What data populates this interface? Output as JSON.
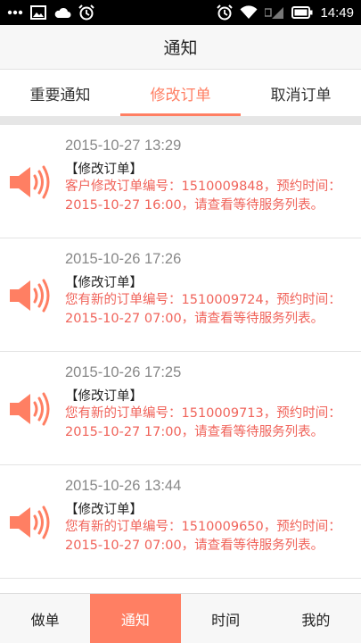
{
  "status_bar": {
    "left_icons": [
      "more-dots-icon",
      "image-icon",
      "cloud-icon",
      "alarm-icon"
    ],
    "right_icons": [
      "alarm-icon",
      "wifi-icon",
      "signal-icon",
      "battery-icon"
    ],
    "time": "14:49"
  },
  "header": {
    "title": "通知"
  },
  "tabs": [
    {
      "label": "重要通知",
      "active": false
    },
    {
      "label": "修改订单",
      "active": true
    },
    {
      "label": "取消订单",
      "active": false
    }
  ],
  "notifications": [
    {
      "time": "2015-10-27 13:29",
      "tag": "【修改订单】",
      "message": "客户修改订单编号：1510009848，预约时间：2015-10-27 16:00，请查看等待服务列表。"
    },
    {
      "time": "2015-10-26 17:26",
      "tag": "【修改订单】",
      "message": "您有新的订单编号：1510009724，预约时间：2015-10-27 07:00，请查看等待服务列表。"
    },
    {
      "time": "2015-10-26 17:25",
      "tag": "【修改订单】",
      "message": "您有新的订单编号：1510009713，预约时间：2015-10-27 17:00，请查看等待服务列表。"
    },
    {
      "time": "2015-10-26 13:44",
      "tag": "【修改订单】",
      "message": "您有新的订单编号：1510009650，预约时间：2015-10-27 07:00，请查看等待服务列表。"
    }
  ],
  "bottom_nav": [
    {
      "label": "做单",
      "active": false
    },
    {
      "label": "通知",
      "active": true
    },
    {
      "label": "时间",
      "active": false
    },
    {
      "label": "我的",
      "active": false
    }
  ],
  "colors": {
    "accent": "#ff7f63",
    "message": "#f0635a"
  }
}
